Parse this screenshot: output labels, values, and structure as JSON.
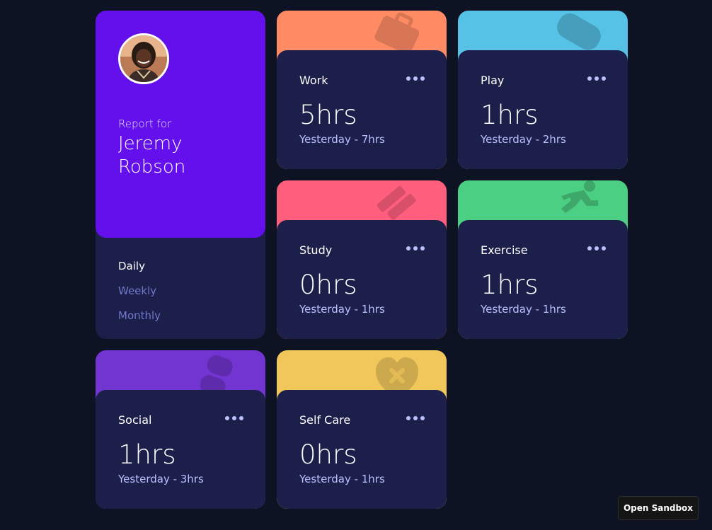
{
  "profile": {
    "report_label": "Report for",
    "name": "Jeremy Robson",
    "avatar_icon": "user-avatar-photo",
    "periods": [
      {
        "label": "Daily",
        "active": true
      },
      {
        "label": "Weekly",
        "active": false
      },
      {
        "label": "Monthly",
        "active": false
      }
    ]
  },
  "colors": {
    "background": "#0e1323",
    "card": "#1c1f4a",
    "profile": "#6410ec",
    "accent_text": "#bbc0ff"
  },
  "activities": [
    {
      "title": "Work",
      "current": "5hrs",
      "previous": "Yesterday - 7hrs",
      "color": "#ff8b64",
      "icon": "briefcase-icon"
    },
    {
      "title": "Play",
      "current": "1hrs",
      "previous": "Yesterday - 2hrs",
      "color": "#55c2e6",
      "icon": "gamepad-icon"
    },
    {
      "title": "Study",
      "current": "0hrs",
      "previous": "Yesterday - 1hrs",
      "color": "#ff5e7d",
      "icon": "books-icon"
    },
    {
      "title": "Exercise",
      "current": "1hrs",
      "previous": "Yesterday - 1hrs",
      "color": "#4bcf82",
      "icon": "running-icon"
    },
    {
      "title": "Social",
      "current": "1hrs",
      "previous": "Yesterday - 3hrs",
      "color": "#7335d2",
      "icon": "chat-icon"
    },
    {
      "title": "Self Care",
      "current": "0hrs",
      "previous": "Yesterday - 1hrs",
      "color": "#f1c75b",
      "icon": "heart-icon"
    }
  ],
  "sandbox_button": "Open Sandbox"
}
